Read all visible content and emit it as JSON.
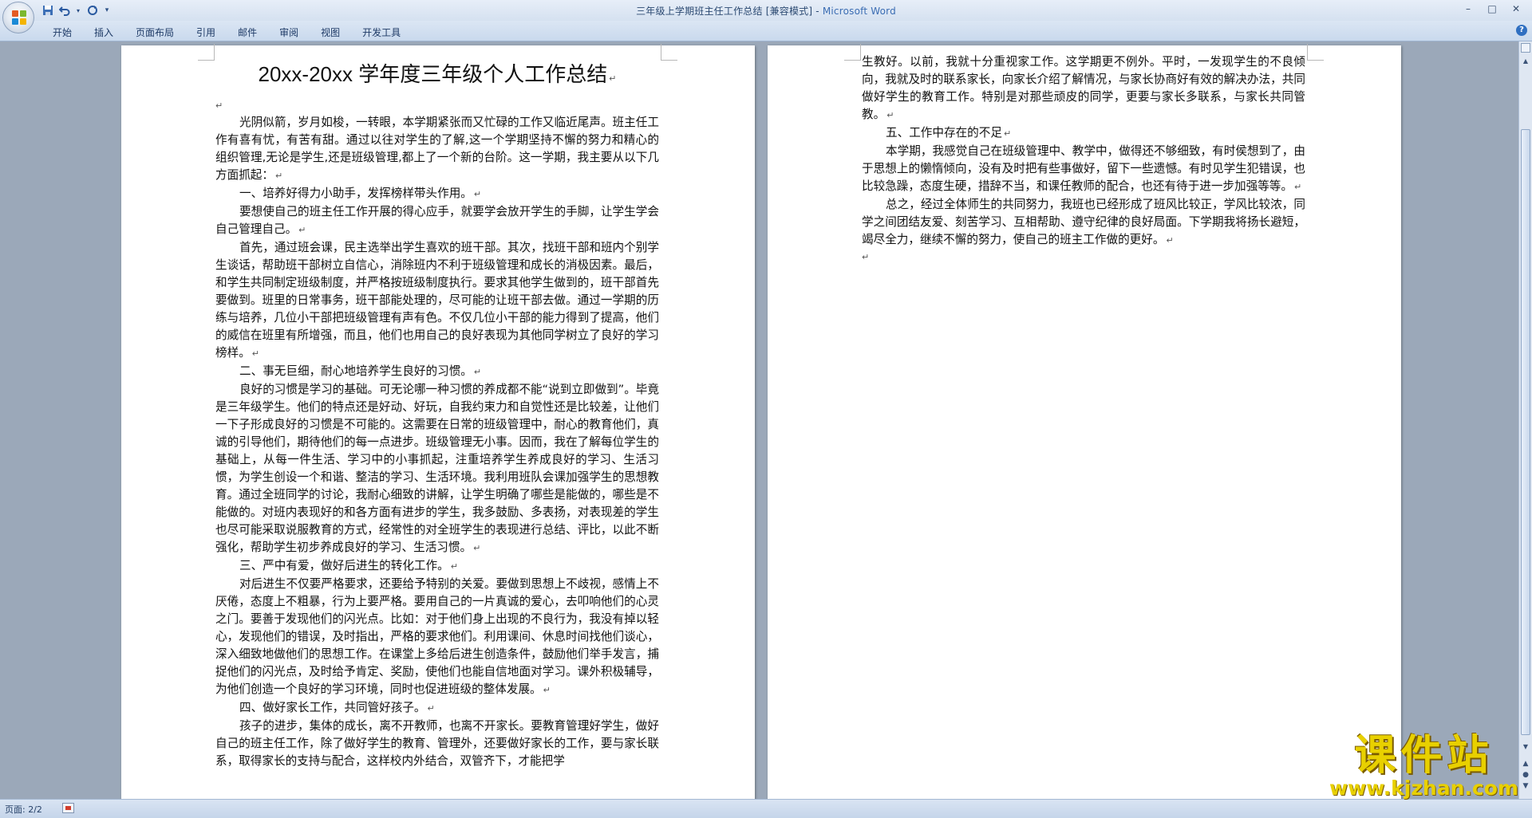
{
  "window": {
    "title_doc": "三年级上学期班主任工作总结 [兼容模式] - ",
    "title_app": "Microsoft Word",
    "controls": [
      "–",
      "□",
      "✕"
    ]
  },
  "quick_access": {
    "save_icon": "save-icon",
    "undo_icon": "undo-icon",
    "redo_icon": "redo-icon",
    "customize_icon": "customize-icon"
  },
  "ribbon": {
    "tabs": [
      "开始",
      "插入",
      "页面布局",
      "引用",
      "邮件",
      "审阅",
      "视图",
      "开发工具"
    ],
    "help": "?"
  },
  "document": {
    "title": "20xx-20xx 学年度三年级个人工作总结",
    "page1": [
      "光阴似箭，岁月如梭，一转眼，本学期紧张而又忙碌的工作又临近尾声。班主任工作有喜有忧，有苦有甜。通过以往对学生的了解,这一个学期坚持不懈的努力和精心的组织管理,无论是学生,还是班级管理,都上了一个新的台阶。这一学期，我主要从以下几方面抓起：",
      "一、培养好得力小助手，发挥榜样带头作用。",
      "要想使自己的班主任工作开展的得心应手，就要学会放开学生的手脚，让学生学会自己管理自己。",
      "首先，通过班会课，民主选举出学生喜欢的班干部。其次，找班干部和班内个别学生谈话，帮助班干部树立自信心，消除班内不利于班级管理和成长的消极因素。最后，和学生共同制定班级制度，并严格按班级制度执行。要求其他学生做到的，班干部首先要做到。班里的日常事务，班干部能处理的，尽可能的让班干部去做。通过一学期的历练与培养，几位小干部把班级管理有声有色。不仅几位小干部的能力得到了提高，他们的威信在班里有所增强，而且，他们也用自己的良好表现为其他同学树立了良好的学习榜样。",
      "二、事无巨细，耐心地培养学生良好的习惯。",
      "良好的习惯是学习的基础。可无论哪一种习惯的养成都不能“说到立即做到”。毕竟是三年级学生。他们的特点还是好动、好玩，自我约束力和自觉性还是比较差，让他们一下子形成良好的习惯是不可能的。这需要在日常的班级管理中，耐心的教育他们，真诚的引导他们，期待他们的每一点进步。班级管理无小事。因而，我在了解每位学生的基础上，从每一件生活、学习中的小事抓起，注重培养学生养成良好的学习、生活习惯，为学生创设一个和谐、整洁的学习、生活环境。我利用班队会课加强学生的思想教育。通过全班同学的讨论，我耐心细致的讲解，让学生明确了哪些是能做的，哪些是不能做的。对班内表现好的和各方面有进步的学生，我多鼓励、多表扬，对表现差的学生也尽可能采取说服教育的方式，经常性的对全班学生的表现进行总结、评比，以此不断强化，帮助学生初步养成良好的学习、生活习惯。",
      "三、严中有爱，做好后进生的转化工作。",
      "对后进生不仅要严格要求，还要给予特别的关爱。要做到思想上不歧视，感情上不厌倦，态度上不粗暴，行为上要严格。要用自己的一片真诚的爱心，去叩响他们的心灵之门。要善于发现他们的闪光点。比如：对于他们身上出现的不良行为，我没有掉以轻心，发现他们的错误，及时指出，严格的要求他们。利用课间、休息时间找他们谈心，深入细致地做他们的思想工作。在课堂上多给后进生创造条件，鼓励他们举手发言，捕捉他们的闪光点，及时给予肯定、奖励，使他们也能自信地面对学习。课外积极辅导，为他们创造一个良好的学习环境，同时也促进班级的整体发展。",
      "四、做好家长工作，共同管好孩子。",
      "孩子的进步，集体的成长，离不开教师，也离不开家长。要教育管理好学生，做好自己的班主任工作，除了做好学生的教育、管理外，还要做好家长的工作，要与家长联系，取得家长的支持与配合，这样校内外结合，双管齐下，才能把学"
    ],
    "page2_continuation": "生教好。以前，我就十分重视家工作。这学期更不例外。平时，一发现学生的不良倾向，我就及时的联系家长，向家长介绍了解情况，与家长协商好有效的解决办法，共同做好学生的教育工作。特别是对那些顽皮的同学，更要与家长多联系，与家长共同管教。",
    "page2": [
      "五、工作中存在的不足",
      "本学期，我感觉自己在班级管理中、教学中，做得还不够细致，有时侯想到了，由于思想上的懒惰倾向，没有及时把有些事做好，留下一些遗憾。有时见学生犯错误，也比较急躁，态度生硬，措辞不当，和课任教师的配合，也还有待于进一步加强等等。",
      "总之，经过全体师生的共同努力，我班也已经形成了班风比较正，学风比较浓，同学之间团结友爱、刻苦学习、互相帮助、遵守纪律的良好局面。下学期我将扬长避短，竭尽全力，继续不懈的努力，使自己的班主工作做的更好。"
    ],
    "paragraph_mark": "↵"
  },
  "statusbar": {
    "page": "页面: 2/2"
  },
  "watermark": {
    "cn": "课件站",
    "url": "www.kjzhan.com"
  }
}
